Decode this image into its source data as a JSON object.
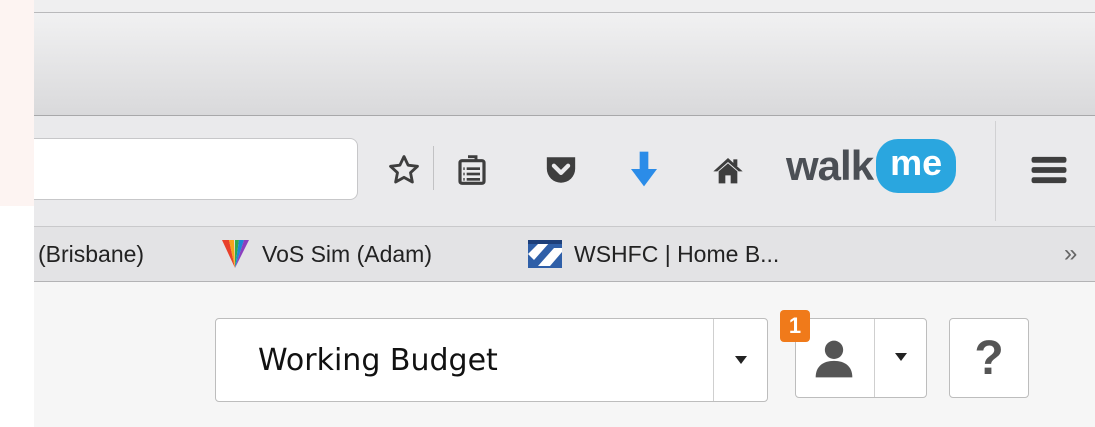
{
  "browser": {
    "toolbar": {
      "icons": [
        "star-icon",
        "reading-list-icon",
        "pocket-icon",
        "download-arrow-icon",
        "home-icon"
      ],
      "download_arrow_color": "#2b8ce8",
      "walkme_logo": {
        "word": "walk",
        "badge": "me",
        "badge_color": "#2aa6df"
      },
      "menu_icon": "hamburger-menu-icon"
    },
    "bookmarks": [
      {
        "label": "(Brisbane)"
      },
      {
        "label": "VoS Sim (Adam)",
        "icon": "vos-sim-favicon"
      },
      {
        "label": "WSHFC | Home B...",
        "icon": "wshfc-favicon"
      }
    ],
    "bookmarks_overflow": "»"
  },
  "page": {
    "budget_select": {
      "value": "Working Budget"
    },
    "notifications": {
      "count": "1",
      "color": "#f07a1a"
    },
    "help": {
      "label": "?"
    }
  }
}
